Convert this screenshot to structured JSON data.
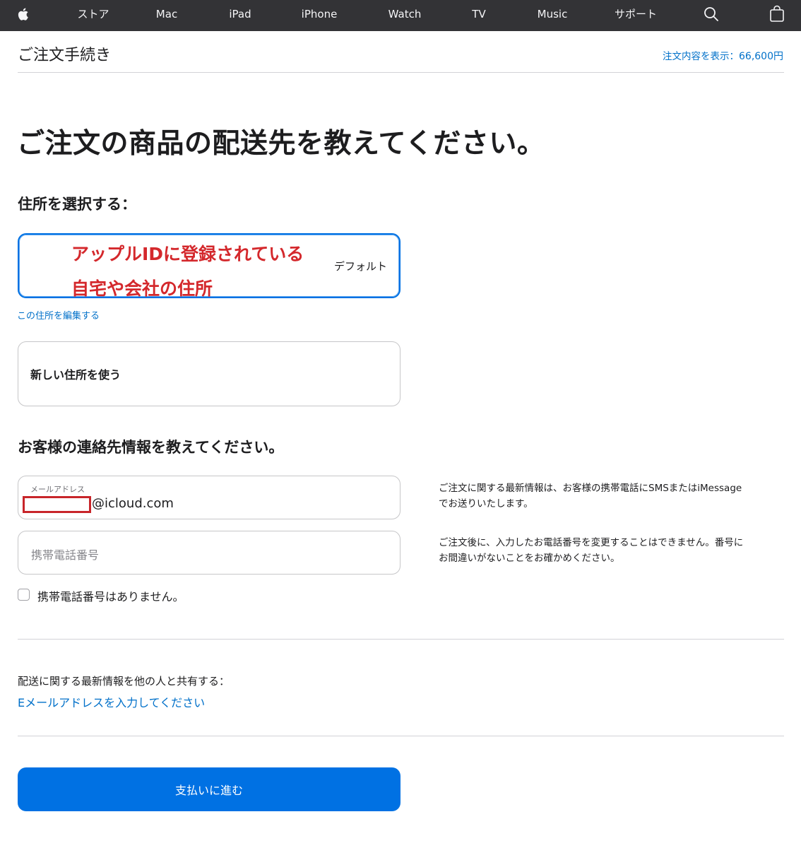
{
  "nav": {
    "items": [
      {
        "label": "ストア"
      },
      {
        "label": "Mac"
      },
      {
        "label": "iPad"
      },
      {
        "label": "iPhone"
      },
      {
        "label": "Watch"
      },
      {
        "label": "TV"
      },
      {
        "label": "Music"
      },
      {
        "label": "サポート"
      }
    ],
    "icons": {
      "logo": "apple-logo-icon",
      "search": "search-icon",
      "bag": "shopping-bag-icon"
    }
  },
  "header": {
    "title": "ご注文手続き",
    "summary_label": "注文内容を表示：",
    "summary_amount": "66,600円"
  },
  "main": {
    "heading": "ご注文の商品の配送先を教えてください。",
    "address_section": {
      "heading": "住所を選択する：",
      "selected_card": {
        "annotation_line1": "アップルIDに登録されている",
        "annotation_line2": "自宅や会社の住所",
        "badge": "デフォルト"
      },
      "edit_link": "この住所を編集する",
      "new_address_label": "新しい住所を使う"
    },
    "contact_section": {
      "heading": "お客様の連絡先情報を教えてください。",
      "email": {
        "label": "メールアドレス",
        "value": "@icloud.com"
      },
      "phone": {
        "placeholder": "携帯電話番号"
      },
      "no_phone_checkbox": {
        "label": "携帯電話番号はありません。",
        "checked": false
      },
      "note_sms": "ご注文に関する最新情報は、お客様の携帯電話にSMSまたはiMessageでお送りいたします。",
      "note_phone": "ご注文後に、入力したお電話番号を変更することはできません。番号にお間違いがないことをお確かめください。"
    },
    "share_section": {
      "label": "配送に関する最新情報を他の人と共有する：",
      "link": "Eメールアドレスを入力してください"
    },
    "pay_button": "支払いに進む"
  },
  "colors": {
    "nav_bg": "#333336",
    "accent": "#0071e3",
    "link": "#0070c9",
    "annotation": "#d4282c"
  }
}
